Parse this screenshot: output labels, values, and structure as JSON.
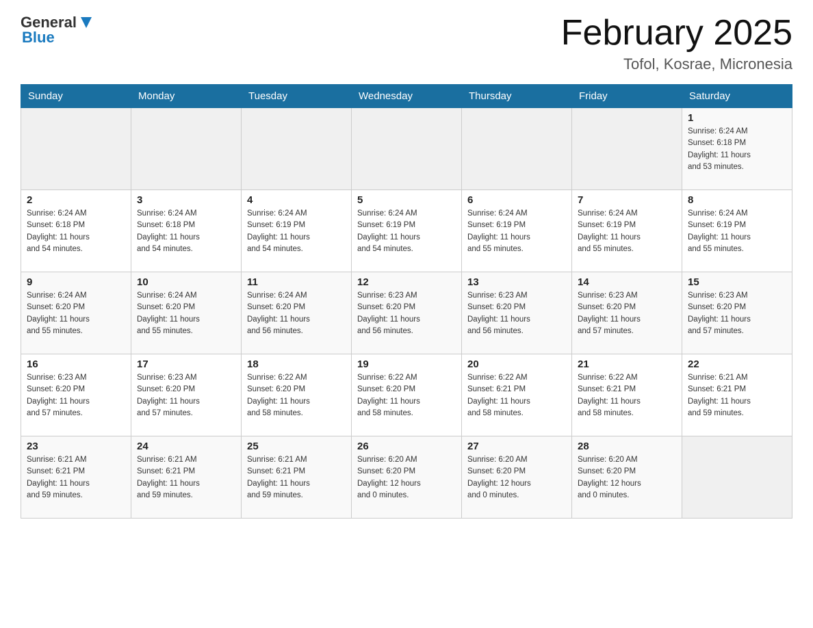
{
  "header": {
    "logo_general": "General",
    "logo_blue": "Blue",
    "title": "February 2025",
    "subtitle": "Tofol, Kosrae, Micronesia"
  },
  "weekdays": [
    "Sunday",
    "Monday",
    "Tuesday",
    "Wednesday",
    "Thursday",
    "Friday",
    "Saturday"
  ],
  "weeks": [
    [
      {
        "day": "",
        "info": ""
      },
      {
        "day": "",
        "info": ""
      },
      {
        "day": "",
        "info": ""
      },
      {
        "day": "",
        "info": ""
      },
      {
        "day": "",
        "info": ""
      },
      {
        "day": "",
        "info": ""
      },
      {
        "day": "1",
        "info": "Sunrise: 6:24 AM\nSunset: 6:18 PM\nDaylight: 11 hours\nand 53 minutes."
      }
    ],
    [
      {
        "day": "2",
        "info": "Sunrise: 6:24 AM\nSunset: 6:18 PM\nDaylight: 11 hours\nand 54 minutes."
      },
      {
        "day": "3",
        "info": "Sunrise: 6:24 AM\nSunset: 6:18 PM\nDaylight: 11 hours\nand 54 minutes."
      },
      {
        "day": "4",
        "info": "Sunrise: 6:24 AM\nSunset: 6:19 PM\nDaylight: 11 hours\nand 54 minutes."
      },
      {
        "day": "5",
        "info": "Sunrise: 6:24 AM\nSunset: 6:19 PM\nDaylight: 11 hours\nand 54 minutes."
      },
      {
        "day": "6",
        "info": "Sunrise: 6:24 AM\nSunset: 6:19 PM\nDaylight: 11 hours\nand 55 minutes."
      },
      {
        "day": "7",
        "info": "Sunrise: 6:24 AM\nSunset: 6:19 PM\nDaylight: 11 hours\nand 55 minutes."
      },
      {
        "day": "8",
        "info": "Sunrise: 6:24 AM\nSunset: 6:19 PM\nDaylight: 11 hours\nand 55 minutes."
      }
    ],
    [
      {
        "day": "9",
        "info": "Sunrise: 6:24 AM\nSunset: 6:20 PM\nDaylight: 11 hours\nand 55 minutes."
      },
      {
        "day": "10",
        "info": "Sunrise: 6:24 AM\nSunset: 6:20 PM\nDaylight: 11 hours\nand 55 minutes."
      },
      {
        "day": "11",
        "info": "Sunrise: 6:24 AM\nSunset: 6:20 PM\nDaylight: 11 hours\nand 56 minutes."
      },
      {
        "day": "12",
        "info": "Sunrise: 6:23 AM\nSunset: 6:20 PM\nDaylight: 11 hours\nand 56 minutes."
      },
      {
        "day": "13",
        "info": "Sunrise: 6:23 AM\nSunset: 6:20 PM\nDaylight: 11 hours\nand 56 minutes."
      },
      {
        "day": "14",
        "info": "Sunrise: 6:23 AM\nSunset: 6:20 PM\nDaylight: 11 hours\nand 57 minutes."
      },
      {
        "day": "15",
        "info": "Sunrise: 6:23 AM\nSunset: 6:20 PM\nDaylight: 11 hours\nand 57 minutes."
      }
    ],
    [
      {
        "day": "16",
        "info": "Sunrise: 6:23 AM\nSunset: 6:20 PM\nDaylight: 11 hours\nand 57 minutes."
      },
      {
        "day": "17",
        "info": "Sunrise: 6:23 AM\nSunset: 6:20 PM\nDaylight: 11 hours\nand 57 minutes."
      },
      {
        "day": "18",
        "info": "Sunrise: 6:22 AM\nSunset: 6:20 PM\nDaylight: 11 hours\nand 58 minutes."
      },
      {
        "day": "19",
        "info": "Sunrise: 6:22 AM\nSunset: 6:20 PM\nDaylight: 11 hours\nand 58 minutes."
      },
      {
        "day": "20",
        "info": "Sunrise: 6:22 AM\nSunset: 6:21 PM\nDaylight: 11 hours\nand 58 minutes."
      },
      {
        "day": "21",
        "info": "Sunrise: 6:22 AM\nSunset: 6:21 PM\nDaylight: 11 hours\nand 58 minutes."
      },
      {
        "day": "22",
        "info": "Sunrise: 6:21 AM\nSunset: 6:21 PM\nDaylight: 11 hours\nand 59 minutes."
      }
    ],
    [
      {
        "day": "23",
        "info": "Sunrise: 6:21 AM\nSunset: 6:21 PM\nDaylight: 11 hours\nand 59 minutes."
      },
      {
        "day": "24",
        "info": "Sunrise: 6:21 AM\nSunset: 6:21 PM\nDaylight: 11 hours\nand 59 minutes."
      },
      {
        "day": "25",
        "info": "Sunrise: 6:21 AM\nSunset: 6:21 PM\nDaylight: 11 hours\nand 59 minutes."
      },
      {
        "day": "26",
        "info": "Sunrise: 6:20 AM\nSunset: 6:20 PM\nDaylight: 12 hours\nand 0 minutes."
      },
      {
        "day": "27",
        "info": "Sunrise: 6:20 AM\nSunset: 6:20 PM\nDaylight: 12 hours\nand 0 minutes."
      },
      {
        "day": "28",
        "info": "Sunrise: 6:20 AM\nSunset: 6:20 PM\nDaylight: 12 hours\nand 0 minutes."
      },
      {
        "day": "",
        "info": ""
      }
    ]
  ],
  "colors": {
    "header_bg": "#1a6fa0",
    "header_text": "#ffffff",
    "border": "#cccccc",
    "row_odd_bg": "#f2f2f2",
    "row_even_bg": "#ffffff",
    "empty_bg": "#eeeeee"
  }
}
